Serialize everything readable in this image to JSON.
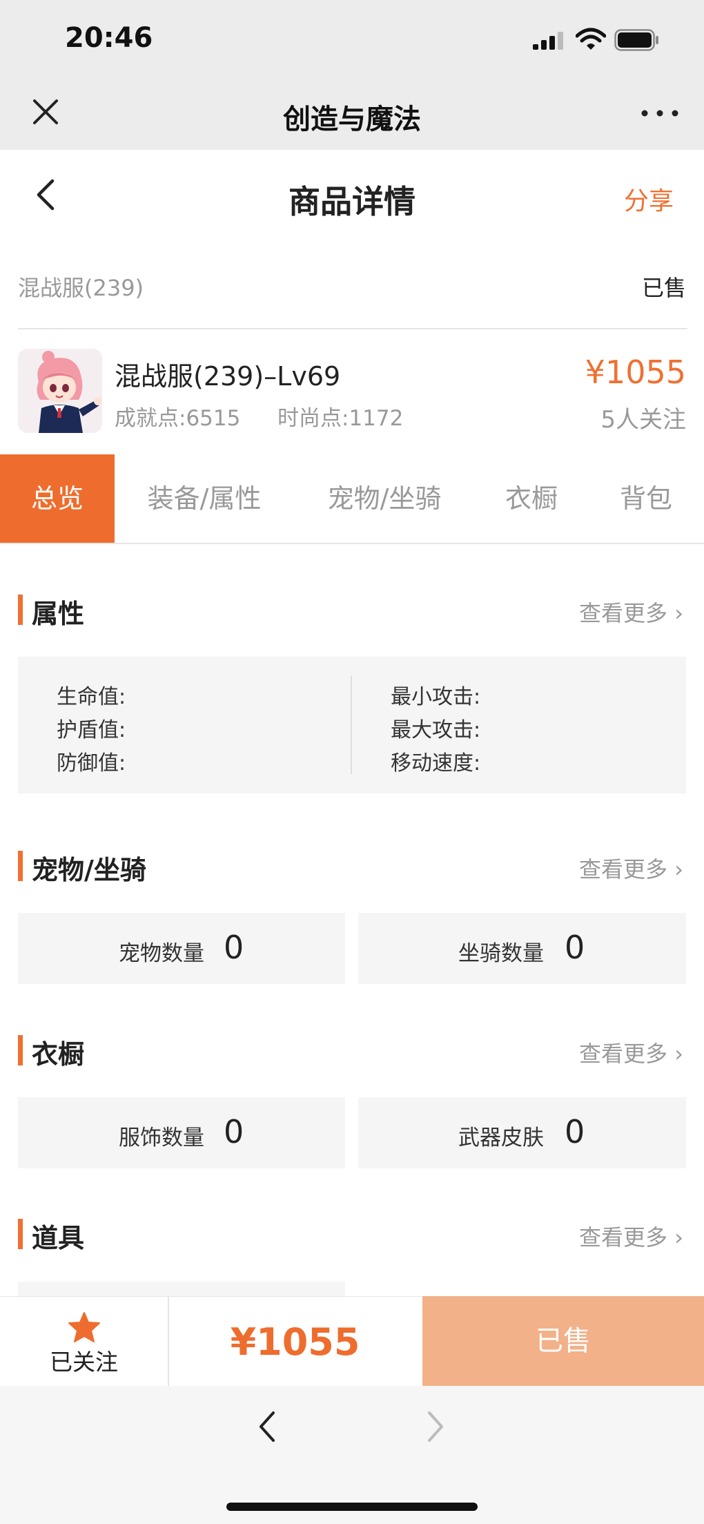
{
  "status_bar": {
    "time": "20:46"
  },
  "mini_program": {
    "title": "创造与魔法"
  },
  "page": {
    "title": "商品详情",
    "share": "分享"
  },
  "server": {
    "name": "混战服(239)",
    "status": "已售"
  },
  "product": {
    "name": "混战服(239)–Lv69",
    "achievement": "成就点:6515",
    "fashion": "时尚点:1172",
    "price": "¥1055",
    "followers": "5人关注"
  },
  "tabs": [
    "总览",
    "装备/属性",
    "宠物/坐骑",
    "衣橱",
    "背包"
  ],
  "sections": {
    "attributes": {
      "title": "属性",
      "more": "查看更多",
      "left": [
        "生命值:",
        "护盾值:",
        "防御值:"
      ],
      "right": [
        "最小攻击:",
        "最大攻击:",
        "移动速度:"
      ]
    },
    "pets": {
      "title": "宠物/坐骑",
      "more": "查看更多",
      "items": [
        {
          "label": "宠物数量",
          "value": "0"
        },
        {
          "label": "坐骑数量",
          "value": "0"
        }
      ]
    },
    "wardrobe": {
      "title": "衣橱",
      "more": "查看更多",
      "items": [
        {
          "label": "服饰数量",
          "value": "0"
        },
        {
          "label": "武器皮肤",
          "value": "0"
        }
      ]
    },
    "props": {
      "title": "道具",
      "more": "查看更多"
    }
  },
  "bottom": {
    "follow_label": "已关注",
    "price": "¥1055",
    "sold_label": "已售"
  },
  "colors": {
    "accent": "#ee6d2e",
    "sold_button": "#f2b189",
    "muted_text": "#999999"
  }
}
